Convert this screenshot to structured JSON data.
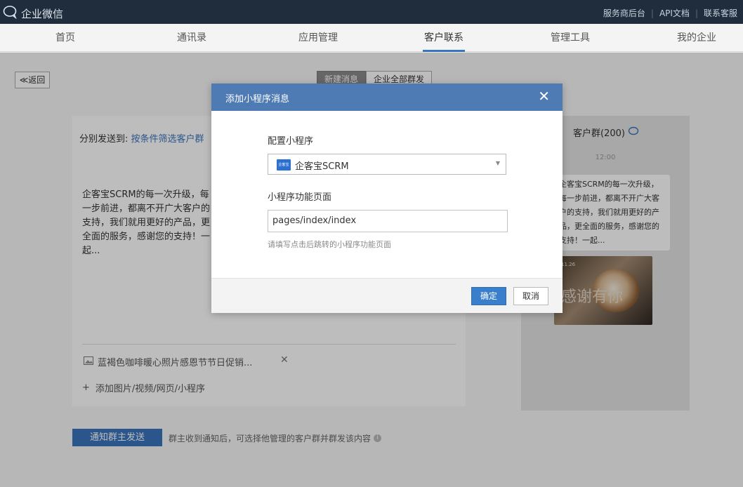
{
  "topbar": {
    "brand": "企业微信",
    "links": [
      "服务商后台",
      "API文档",
      "联系客服"
    ]
  },
  "nav": {
    "items": [
      "首页",
      "通讯录",
      "应用管理",
      "客户联系",
      "管理工具",
      "我的企业"
    ],
    "active": "客户联系"
  },
  "page": {
    "back_label": "≪返回",
    "tabs": [
      "新建消息",
      "企业全部群发"
    ],
    "sendto_prefix": "分别发送到:",
    "sendto_link": "按条件筛选客户群",
    "message_text": "企客宝SCRM的每一次升级，每一步前进，都离不开广大客户的支持，我们就用更好的产品，更全面的服务，感谢您的支持！一起...",
    "attachment_name": "蓝褐色咖啡暖心照片感恩节节日促销...",
    "attachment_close": "✕",
    "add_media": "添加图片/视频/网页/小程序",
    "notify_button": "通知群主发送",
    "notify_tip": "群主收到通知后，可选择他管理的客户群并群发该内容"
  },
  "preview": {
    "title": "客户群(200)",
    "time": "12:00",
    "bubble_text": "企客宝SCRM的每一次升级，每一步前进，都离不开广大客户的支持，我们就用更好的产品，更全面的服务，感谢您的支持！一起...",
    "image_date": "11.26",
    "image_script": "感谢有你"
  },
  "modal": {
    "title": "添加小程序消息",
    "close": "✕",
    "config_label": "配置小程序",
    "selected_app": "企客宝SCRM",
    "app_logo_text": "企客宝",
    "page_label": "小程序功能页面",
    "page_value": "pages/index/index",
    "hint": "请填写点击后跳转的小程序功能页面",
    "ok": "确定",
    "cancel": "取消"
  }
}
